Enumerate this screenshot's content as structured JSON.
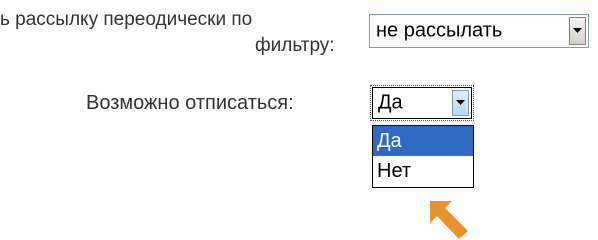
{
  "form": {
    "mailing_label_line1": "ь рассылку переодически по",
    "mailing_label_line2": "фильтру:",
    "mailing_select_value": "не рассылать",
    "unsubscribe_label": "Возможно отписаться:",
    "unsubscribe_select_value": "Да",
    "unsubscribe_options": [
      "Да",
      "Нет"
    ],
    "unsubscribe_selected_index": 0
  },
  "icons": {
    "dropdown_arrow": "chevron-down-icon",
    "pointer": "arrow-pointer-icon"
  },
  "colors": {
    "highlight": "#316ac5",
    "pointer_orange": "#e8922e",
    "label_text": "#333333"
  }
}
